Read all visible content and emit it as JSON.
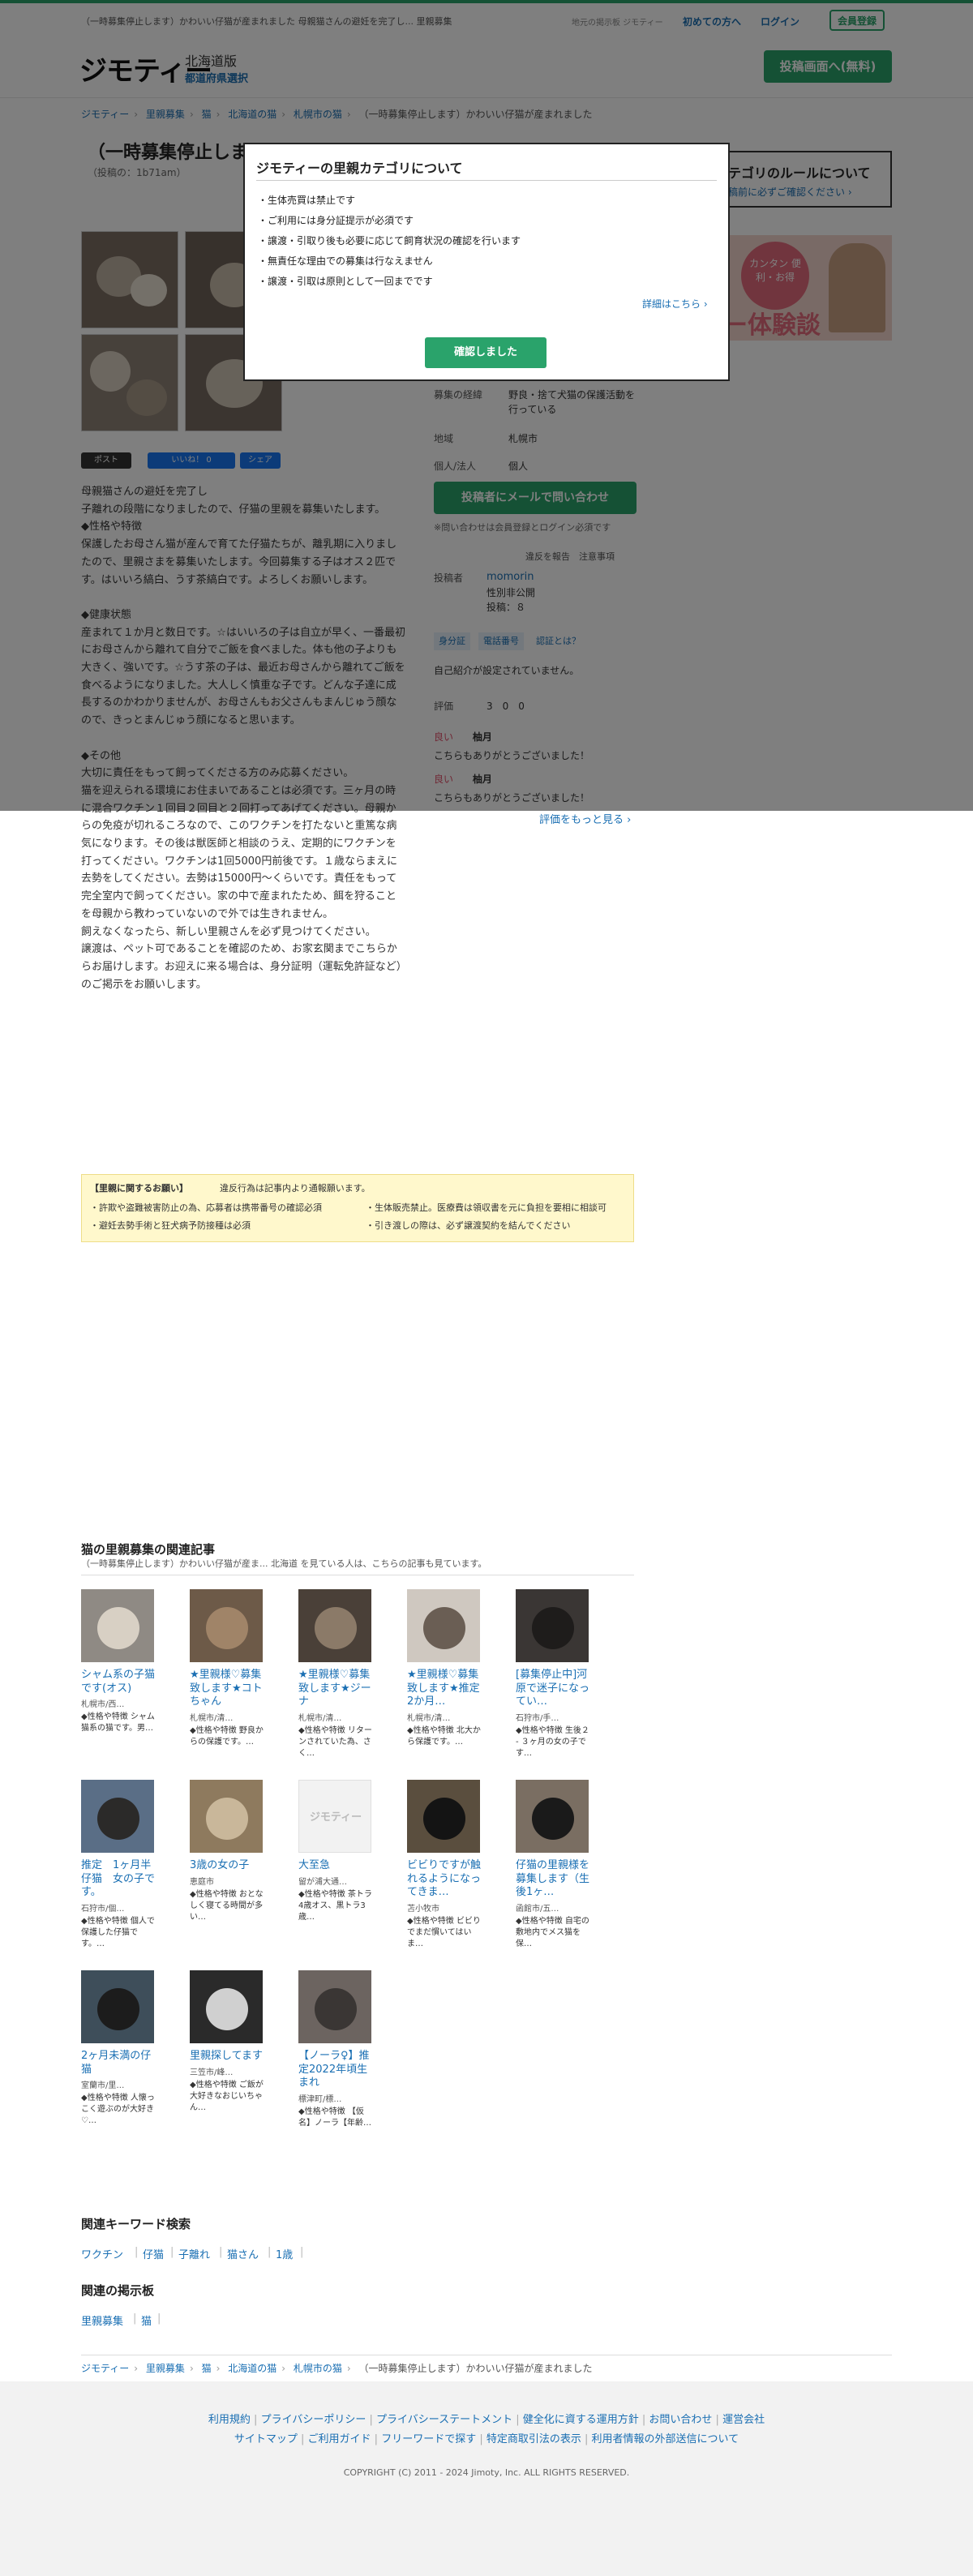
{
  "topbar": {
    "notice_text": "（一時募集停止します）かわいい仔猫が産まれました 母親猫さんの避妊を完了し... 里親募集",
    "mid_text": "地元の掲示板 ジモティー",
    "link_first": "初めての方へ",
    "link_login": "ログイン",
    "btn_register": "会員登録"
  },
  "header": {
    "logo": "ジモティー",
    "region": "北海道版",
    "region_select": "都道府県選択",
    "post_button": "投稿画面へ(無料)"
  },
  "breadcrumb": [
    "ジモティー",
    "里親募集",
    "猫",
    "北海道の猫",
    "札幌市の猫",
    "（一時募集停止します）かわいい仔猫が産まれました"
  ],
  "listing": {
    "title": "（一時募集停止します",
    "posted": "（投稿の：1b71am）",
    "share_labels": [
      "ポスト",
      "いいね！ 0",
      "シェア"
    ],
    "description": "母親猫さんの避妊を完了し\n子離れの段階になりましたので、仔猫の里親を募集いたします。\n◆性格や特徴\n保護したお母さん猫が産んで育てた仔猫たちが、離乳期に入りましたので、里親さまを募集いたします。今回募集する子はオス２匹です。はいいろ縞白、うす茶縞白です。よろしくお願いします。\n\n◆健康状態\n産まれて１か月と数日です。☆はいいろの子は自立が早く、一番最初にお母さんから離れて自分でご飯を食べました。体も他の子よりも大きく、強いです。☆うす茶の子は、最近お母さんから離れてご飯を食べるようになりました。大人しく慎重な子です。どんな子達に成長するのかわかりませんが、お母さんもお父さんもまんじゅう顔なので、きっとまんじゅう顔になると思います。\n\n◆その他\n大切に責任をもって飼ってくださる方のみ応募ください。\n猫を迎えられる環境にお住まいであることは必須です。三ヶ月の時に混合ワクチン１回目２回目と２回打ってあげてください。母親からの免疫が切れるころなので、このワクチンを打たないと重篤な病気になります。その後は獣医師と相談のうえ、定期的にワクチンを打ってください。ワクチンは1回5000円前後です。１歳ならまえに去勢をしてください。去勢は15000円〜くらいです。責任をもって完全室内で飼ってください。家の中で産まれたため、餌を狩ることを母親から教わっていないので外では生きれません。\n飼えなくなったら、新しい里親さんを必ず見つけてください。\n譲渡は、ペット可であることを確認のため、お家玄関までこちらからお届けします。お迎えに来る場合は、身分証明（運転免許証など）のご掲示をお願いします。"
  },
  "sidebar": {
    "rule_box_title": "テゴリのルールについて",
    "rule_box_link": "稿前に必ずご確認ください ›",
    "banner_circle": "カンタン 便利・お得",
    "banner_big": "ー体験談"
  },
  "info": {
    "reason_label": "募集の経緯",
    "reason_value": "野良・捨て犬猫の保護活動を行っている",
    "area_label": "地域",
    "area_value": "札幌市",
    "type_label": "個人/法人",
    "type_value": "個人",
    "mail_button": "投稿者にメールで問い合わせ",
    "mail_note": "※問い合わせは会員登録とログイン必須です",
    "report_links": "違反を報告　注意事項",
    "poster_label": "投稿者",
    "poster_name": "momorin",
    "poster_gender": "性別非公開",
    "poster_posts": "投稿：８",
    "tags": [
      "身分証",
      "電話番号",
      "認証とは？"
    ],
    "no_intro": "自己紹介が設定されていません。",
    "rating_label": "評価",
    "rating_values": "3　0　0",
    "reviews": [
      {
        "grade": "良い",
        "name": "柚月",
        "text": "こちらもありがとうございました！"
      },
      {
        "grade": "良い",
        "name": "柚月",
        "text": "こちらもありがとうございました！"
      }
    ],
    "more_reviews": "評価をもっと見る ›"
  },
  "notice": {
    "title": "【里親に関するお願い】",
    "title_note": "違反行為は記事内より通報願います。",
    "items": [
      "・許欺や盗難被害防止の為、応募者は携帯番号の確認必須",
      "・生体販売禁止。医療費は領収書を元に負担を要相に相談可",
      "・避妊去勢手術と狂犬病予防接種は必須",
      "・引き渡しの際は、必ず譲渡契約を結んでください"
    ]
  },
  "related": {
    "title": "猫の里親募集の関連記事",
    "subtitle": "（一時募集停止します）かわいい仔猫が産ま... 北海道 を見ている人は、こちらの記事も見ています。",
    "cards": [
      {
        "title": "シャム系の子猫です(オス)",
        "loc": "札幌市/西…",
        "snip": "◆性格や特徴 シャム猫系の猫です。男…"
      },
      {
        "title": "★里親様♡募集致します★コトちゃん",
        "loc": "札幌市/清…",
        "snip": "◆性格や特徴 野良からの保護です。…"
      },
      {
        "title": "★里親様♡募集致します★ジーナ",
        "loc": "札幌市/清…",
        "snip": "◆性格や特徴 リターンされていた為、さく…"
      },
      {
        "title": "★里親様♡募集致します★推定2か月…",
        "loc": "札幌市/清…",
        "snip": "◆性格や特徴 北大から保護です。…"
      },
      {
        "title": "[募集停止中]河原で迷子になってい…",
        "loc": "石狩市/手…",
        "snip": "◆性格や特徴 生後２ - ３ヶ月の女の子です…"
      },
      {
        "title": "推定　1ヶ月半　仔猫　女の子です。",
        "loc": "石狩市/個…",
        "snip": "◆性格や特徴 個人で保護した仔猫です。…"
      },
      {
        "title": "3歳の女の子",
        "loc": "恵庭市",
        "snip": "◆性格や特徴 おとなしく寝てる時間が多い…"
      },
      {
        "title": "大至急",
        "loc": "留が浦大通…",
        "snip": "◆性格や特徴 茶トラ4歳オス、黒トラ3歳…"
      },
      {
        "title": "ビビりですが触れるようになってきま…",
        "loc": "苫小牧市",
        "snip": "◆性格や特徴 ビビりでまだ慣いてはいま…"
      },
      {
        "title": "仔猫の里親様を募集します（生後1ヶ…",
        "loc": "函館市/五…",
        "snip": "◆性格や特徴 自宅の敷地内でメス猫を保…"
      },
      {
        "title": "2ヶ月未満の仔猫",
        "loc": "室蘭市/里…",
        "snip": "◆性格や特徴 人懐っこく遊ぶのが大好き♡…"
      },
      {
        "title": "里親探してます",
        "loc": "三笠市/峰…",
        "snip": "◆性格や特徴 ご飯が大好きなおじいちゃん…"
      },
      {
        "title": "【ノーラ♀】推定2022年頃生まれ",
        "loc": "標津町/標…",
        "snip": "◆性格や特徴 【仮名】ノーラ【年齢…"
      }
    ],
    "placeholder_logo": "ジモティー"
  },
  "keywords": {
    "title": "関連キーワード検索",
    "items": [
      "ワクチン",
      "仔猫",
      "子離れ",
      "猫さん",
      "1歳"
    ]
  },
  "boards": {
    "title": "関連の掲示板",
    "items": [
      "里親募集",
      "猫"
    ]
  },
  "footer": {
    "row1": [
      "利用規約",
      "プライバシーポリシー",
      "プライバシーステートメント",
      "健全化に資する運用方針",
      "お問い合わせ",
      "運営会社"
    ],
    "row2": [
      "サイトマップ",
      "ご利用ガイド",
      "フリーワードで探す",
      "特定商取引法の表示",
      "利用者情報の外部送信について"
    ],
    "copyright": "COPYRIGHT (C) 2011 - 2024 Jimoty, Inc. ALL RIGHTS RESERVED."
  },
  "modal": {
    "title": "ジモティーの里親カテゴリについて",
    "items": [
      "・生体売買は禁止です",
      "・ご利用には身分証提示が必須です",
      "・譲渡・引取り後も必要に応じて飼育状況の確認を行います",
      "・無責任な理由での募集は行なえません",
      "・譲渡・引取は原則として一回までです"
    ],
    "more_link": "詳細はこちら ›",
    "confirm_button": "確認しました"
  },
  "colors": {
    "brand_green": "#2aa36b",
    "link_blue": "#1a6fb3",
    "notice_yellow": "#fff8cc"
  }
}
